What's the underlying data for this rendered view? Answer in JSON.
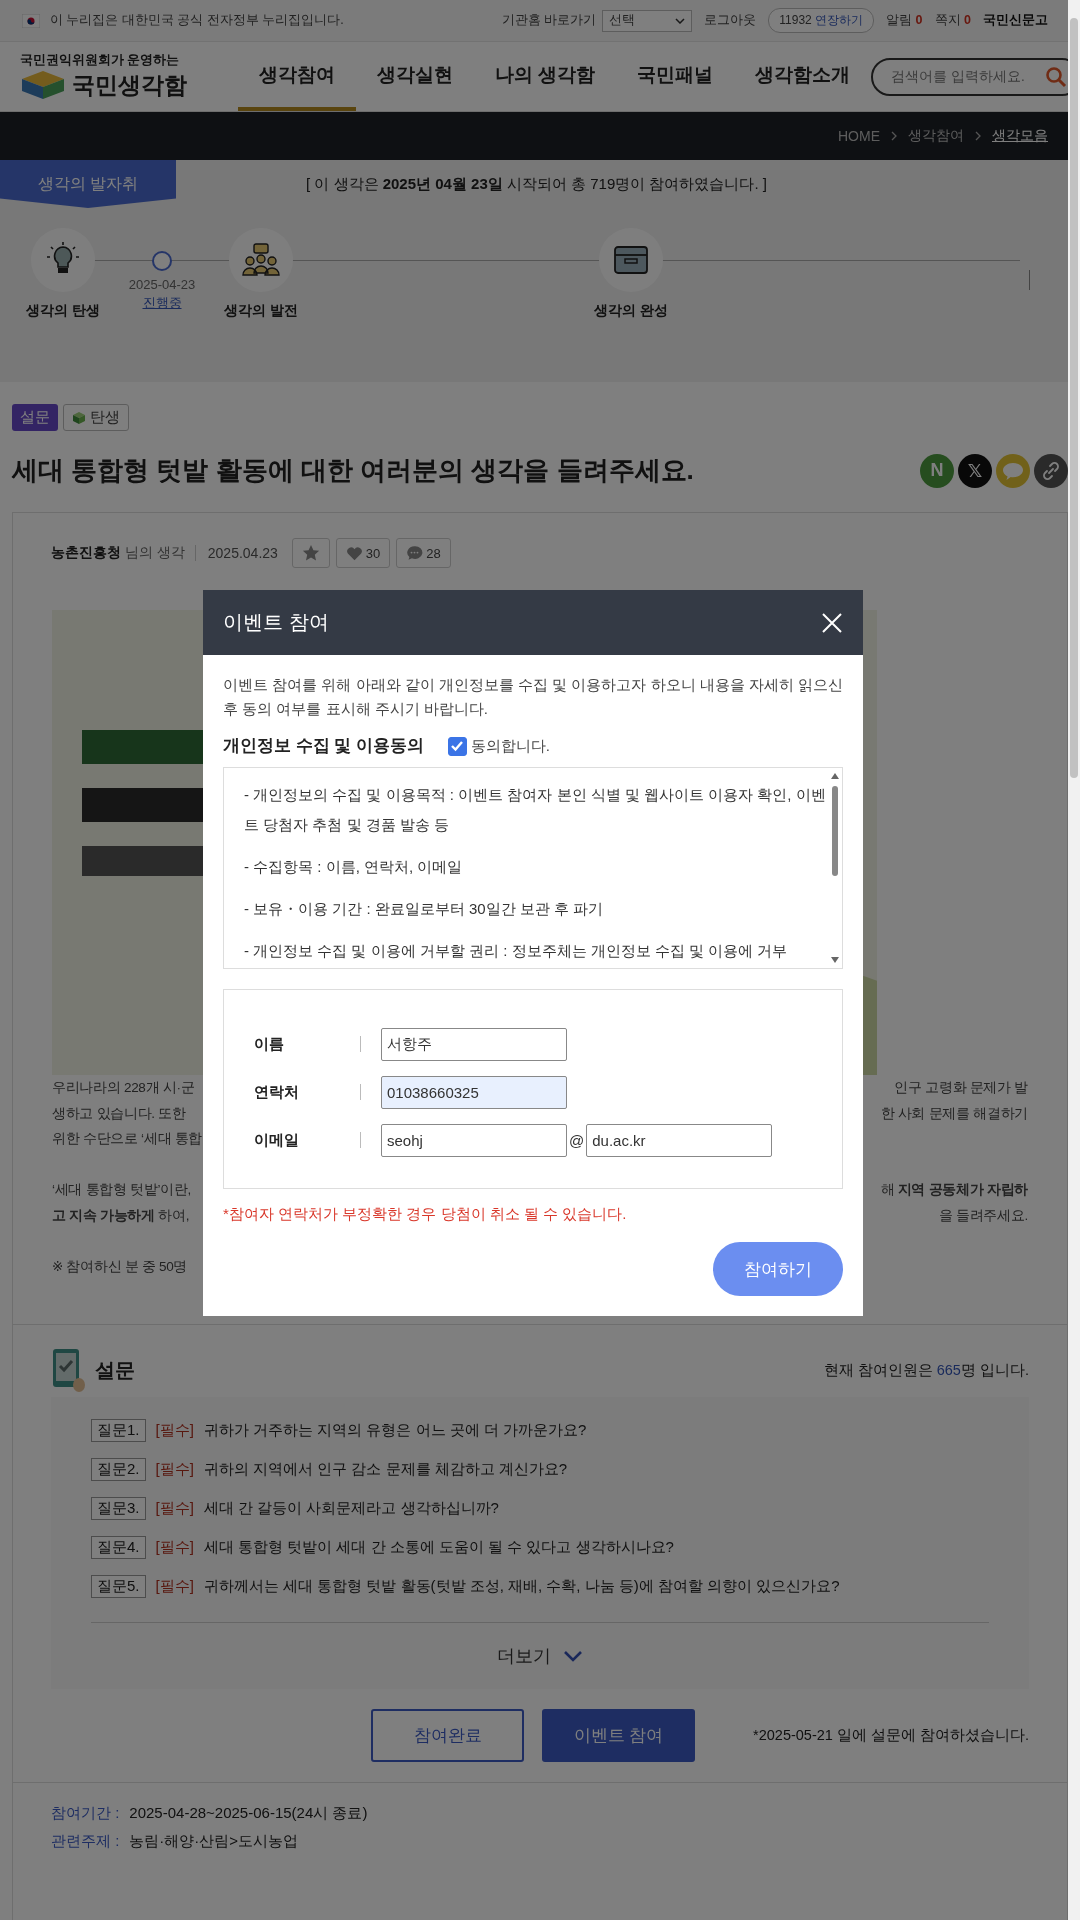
{
  "top_bar": {
    "notice": "이 누리집은 대한민국 공식 전자정부 누리집입니다.",
    "agency_label": "기관홈 바로가기",
    "agency_select": "선택",
    "logout": "로그아웃",
    "session_time": "11932",
    "extend": "연장하기",
    "alerts": [
      {
        "label": "알림",
        "count": "0"
      },
      {
        "label": "쪽지",
        "count": "0"
      }
    ],
    "report": "국민신문고"
  },
  "header": {
    "tagline": "국민권익위원회가 운영하는",
    "logo": "국민생각함",
    "search": {
      "placeholder": "검색어를 입력하세요."
    },
    "nav": [
      {
        "label": "생각참여",
        "selected": true
      },
      {
        "label": "생각실현",
        "selected": false
      },
      {
        "label": "나의 생각함",
        "selected": false
      },
      {
        "label": "국민패널",
        "selected": false
      },
      {
        "label": "생각함소개",
        "selected": false
      }
    ]
  },
  "breadcrumb": [
    "HOME",
    "생각참여",
    "생각모음"
  ],
  "progress": {
    "badge": "생각의 발자취",
    "summary": "[ 이 생각은 **2025년 04월 23일** 시작되어 총 719명이 참여하였습니다. ]",
    "steps": [
      {
        "kind": "stage",
        "label": "생각의 탄생"
      },
      {
        "kind": "current",
        "date": "2025-04-23",
        "status": "진행중"
      },
      {
        "kind": "stage",
        "label": "생각의 발전"
      },
      {
        "kind": "stage",
        "label": "생각의 완성"
      }
    ]
  },
  "tags": [
    {
      "kind": "type",
      "label": "설문"
    },
    {
      "kind": "stage",
      "label": "탄생"
    }
  ],
  "title": "세대 통합형 텃밭 활동에 대한 여러분의 생각을 들려주세요.",
  "share_labels": [
    "N",
    "𝕏"
  ],
  "post": {
    "author": "농촌진흥청",
    "author_suffix": "님의 생각",
    "date": "2025.04.23",
    "likes": "30",
    "comments": "28"
  },
  "body_paragraphs": [
    [
      {
        "left": "우리나라의 228개 시·군",
        "right": "인구 고령화 문제가 발"
      },
      {
        "left": "생하고 있습니다. 또한",
        "right": "한 사회 문제를 해결하기"
      },
      {
        "left": "위한 수단으로 ‘세대 통합"
      }
    ],
    [
      {
        "left": "‘세대 통합형 텃밭’이란,",
        "right": "해 **지역 공동체가 자립하**"
      },
      {
        "left": "**고 지속 가능하게** 하여,",
        "right": "을 들려주세요."
      }
    ],
    [
      {
        "left": "※ 참여하신 분 중 50명"
      }
    ]
  ],
  "survey": {
    "title": "설문",
    "count_prefix": "현재 참여인원은 ",
    "count": "665",
    "count_suffix": "명 입니다.",
    "questions": [
      {
        "number": "질문1.",
        "tag": "[필수]",
        "text": "귀하가 거주하는 지역의 유형은 어느 곳에 더 가까운가요?"
      },
      {
        "number": "질문2.",
        "tag": "[필수]",
        "text": "귀하의 지역에서 인구 감소 문제를 체감하고 계신가요?"
      },
      {
        "number": "질문3.",
        "tag": "[필수]",
        "text": "세대 간 갈등이 사회문제라고 생각하십니까?"
      },
      {
        "number": "질문4.",
        "tag": "[필수]",
        "text": "세대 통합형 텃밭이 세대 간 소통에 도움이 될 수 있다고 생각하시나요?"
      },
      {
        "number": "질문5.",
        "tag": "[필수]",
        "text": "귀하께서는 세대 통합형 텃밭 활동(텃밭 조성, 재배, 수확, 나눔 등)에 참여할 의향이 있으신가요?"
      }
    ],
    "more": "더보기",
    "buttons": [
      {
        "kind": "outline",
        "label": "참여완료"
      },
      {
        "kind": "solid",
        "label": "이벤트 참여"
      }
    ],
    "note": "*2025-05-21 일에 설문에 참여하셨습니다."
  },
  "info": [
    {
      "label": "참여기간 :",
      "value": "2025-04-28~2025-06-15(24시 종료)"
    },
    {
      "label": "관련주제 :",
      "value": "농림·해양·산림>도시농업"
    }
  ],
  "modal": {
    "title": "이벤트 참여",
    "intro": "이벤트 참여를 위해 아래와 같이 개인정보를 수집 및 이용하고자 하오니 내용을 자세히 읽으신 후 동의 여부를 표시해 주시기 바랍니다.",
    "consent_heading": "개인정보 수집 및 이용동의",
    "consent_label": "동의합니다.",
    "consent_checked": true,
    "terms": [
      "- 개인정보의 수집 및 이용목적 : 이벤트 참여자 본인 식별 및 웹사이트 이용자 확인, 이벤트 당첨자 추첨 및 경품 발송 등",
      "- 수집항목 : 이름, 연락처, 이메일",
      "- 보유・이용 기간 : 완료일로부터 30일간 보관 후 파기",
      "- 개인정보 수집 및 이용에 거부할 권리 : 정보주체는 개인정보 수집 및 이용에 거부"
    ],
    "fields": [
      {
        "kind": "text",
        "label": "이름",
        "value": "서항주",
        "highlighted": false
      },
      {
        "kind": "text",
        "label": "연락처",
        "value": "01038660325",
        "highlighted": true
      },
      {
        "kind": "email",
        "label": "이메일",
        "value": "seohj",
        "separator": "@",
        "domain": "du.ac.kr",
        "highlighted": false
      }
    ],
    "warning": "*참여자 연락처가 부정확한 경우 당첨이 취소 될 수 있습니다.",
    "submit": "참여하기"
  }
}
